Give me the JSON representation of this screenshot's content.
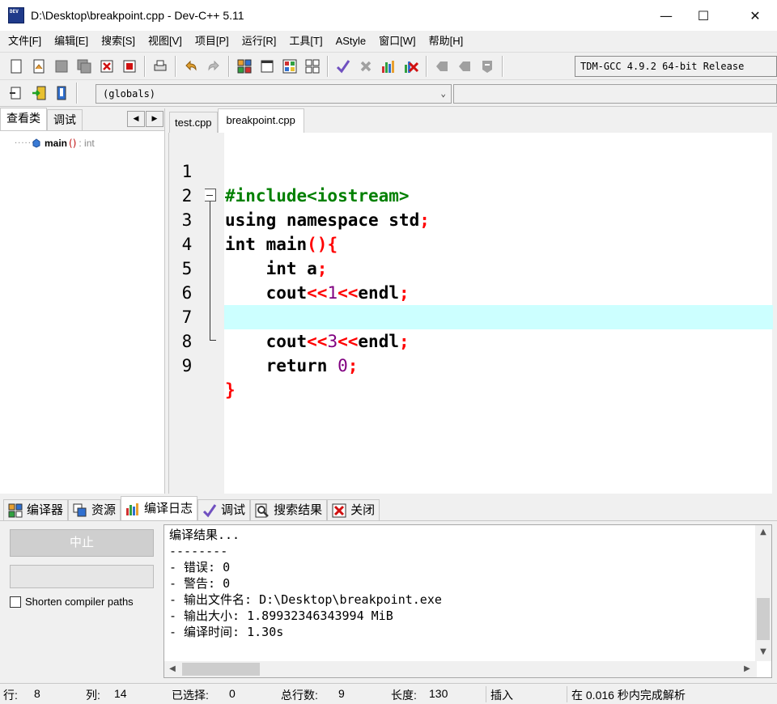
{
  "window": {
    "title": "D:\\Desktop\\breakpoint.cpp - Dev-C++ 5.11"
  },
  "menu": [
    "文件[F]",
    "编辑[E]",
    "搜索[S]",
    "视图[V]",
    "项目[P]",
    "运行[R]",
    "工具[T]",
    "AStyle",
    "窗口[W]",
    "帮助[H]"
  ],
  "toolbar": {
    "compiler": "TDM-GCC 4.9.2 64-bit Release",
    "scope": "(globals)"
  },
  "class_browser": {
    "tabs": [
      "查看类",
      "调试"
    ],
    "item": {
      "name": "main",
      "parens": "()",
      "type": ": int"
    }
  },
  "editor": {
    "tabs": [
      "test.cpp",
      "breakpoint.cpp"
    ],
    "line_numbers": [
      "1",
      "2",
      "3",
      "4",
      "5",
      "6",
      "7",
      "8",
      "9"
    ]
  },
  "bottom_tabs": [
    "编译器",
    "资源",
    "编译日志",
    "调试",
    "搜索结果",
    "关闭"
  ],
  "compile": {
    "stop_label": "中止",
    "shorten_label": "Shorten compiler paths",
    "log": [
      "编译结果...",
      "--------",
      "- 错误: 0",
      "- 警告: 0",
      "- 输出文件名: D:\\Desktop\\breakpoint.exe",
      "- 输出大小: 1.89932346343994 MiB",
      "- 编译时间: 1.30s"
    ]
  },
  "status": {
    "row_label": "行:",
    "row": "8",
    "col_label": "列:",
    "col": "14",
    "sel_label": "已选择:",
    "sel": "0",
    "total_label": "总行数:",
    "total": "9",
    "len_label": "长度:",
    "len": "130",
    "mode": "插入",
    "parse": "在 0.016 秒内完成解析"
  }
}
